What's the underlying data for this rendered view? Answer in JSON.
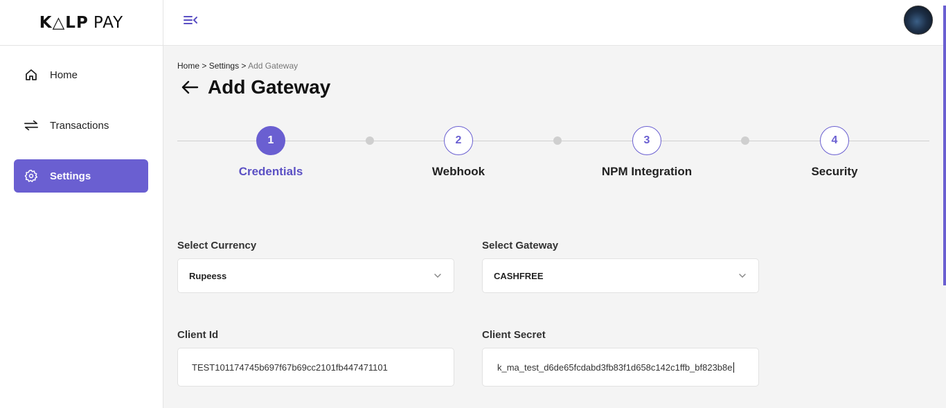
{
  "brand": {
    "name": "K△LP",
    "suffix": "PAY"
  },
  "sidebar": {
    "items": [
      {
        "label": "Home",
        "icon": "home-icon"
      },
      {
        "label": "Transactions",
        "icon": "swap-arrows-icon"
      },
      {
        "label": "Settings",
        "icon": "gear-icon",
        "active": true
      }
    ]
  },
  "topbar": {
    "menu_icon": "menu-collapse-icon",
    "avatar": "user-avatar"
  },
  "breadcrumb": {
    "home": "Home",
    "sep1": " > ",
    "settings": "Settings",
    "sep2": " > ",
    "current": "Add Gateway"
  },
  "page": {
    "title": "Add Gateway",
    "back_icon": "back-arrow-icon"
  },
  "stepper": {
    "steps": [
      {
        "number": "1",
        "label": "Credentials",
        "active": true
      },
      {
        "number": "2",
        "label": "Webhook"
      },
      {
        "number": "3",
        "label": "NPM Integration"
      },
      {
        "number": "4",
        "label": "Security"
      }
    ]
  },
  "form": {
    "currency": {
      "label": "Select Currency",
      "value": "Rupeess"
    },
    "gateway": {
      "label": "Select Gateway",
      "value": "CASHFREE"
    },
    "client_id": {
      "label": "Client Id",
      "value": "TEST101174745b697f67b69cc2101fb447471101"
    },
    "client_secret": {
      "label": "Client Secret",
      "value": "k_ma_test_d6de65fcdabd3fb83f1d658c142c1ffb_bf823b8e"
    }
  },
  "colors": {
    "accent": "#6a5fd1",
    "background": "#f4f4f4"
  }
}
